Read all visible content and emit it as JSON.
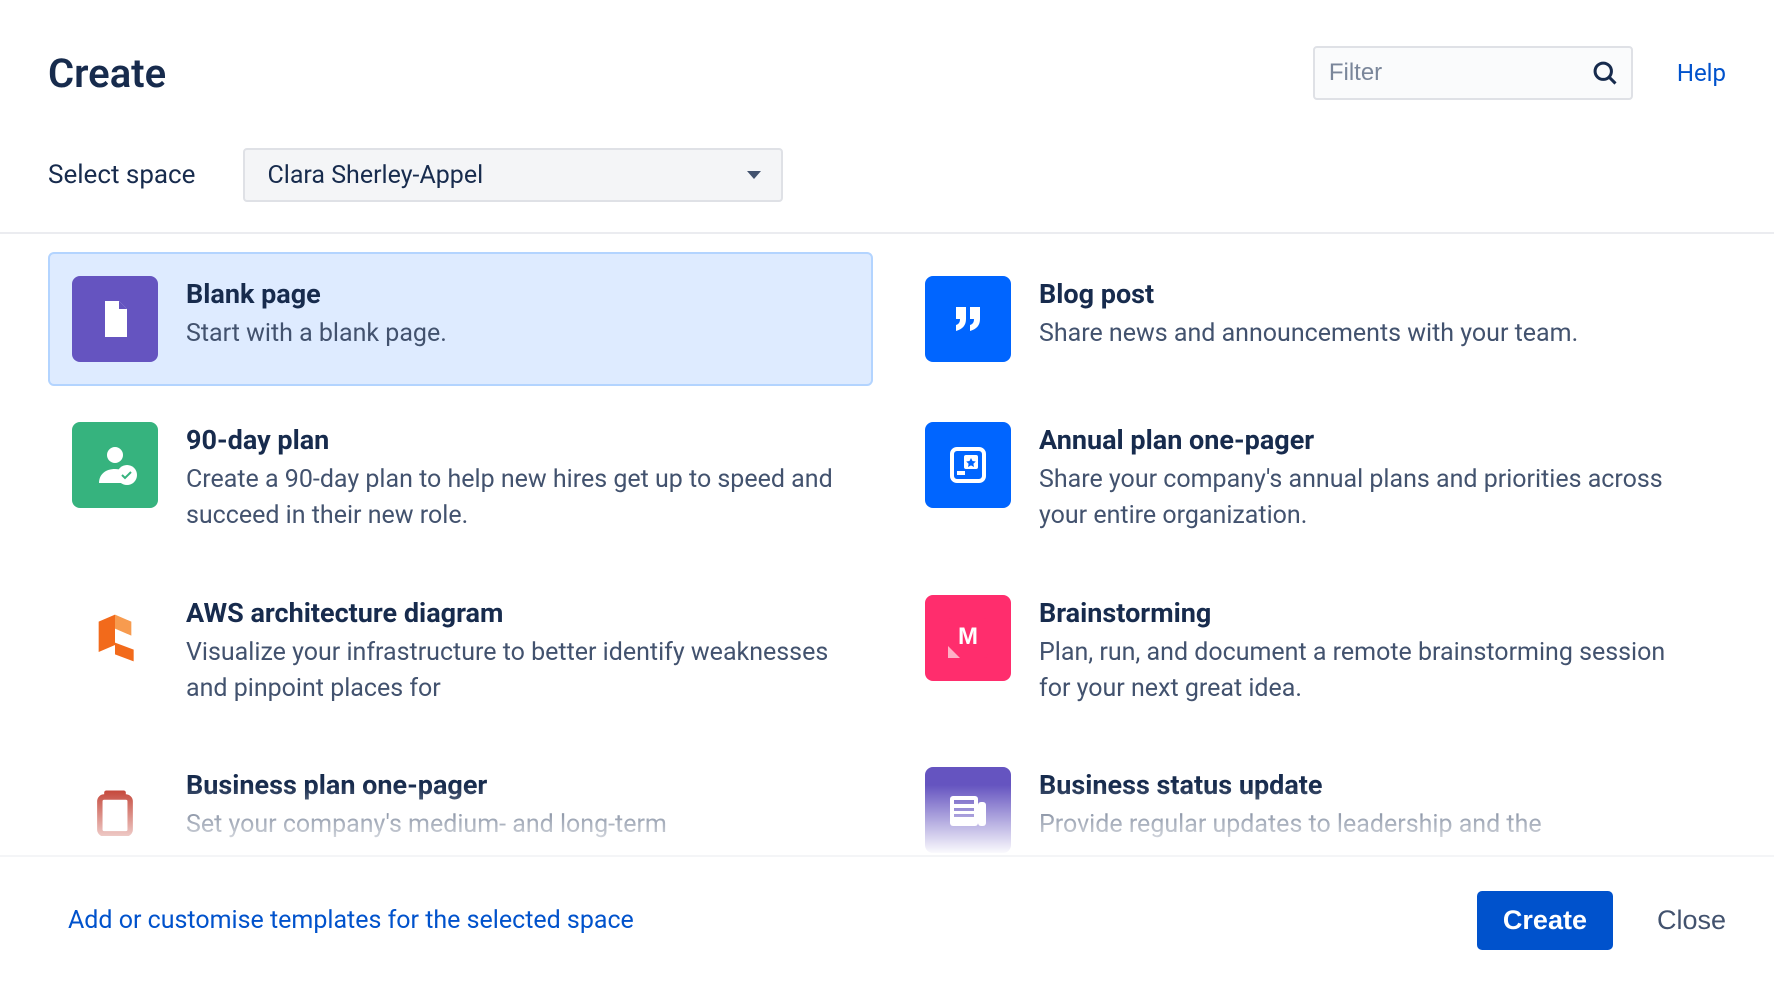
{
  "header": {
    "title": "Create",
    "filter_placeholder": "Filter",
    "help_label": "Help"
  },
  "space": {
    "label": "Select space",
    "selected": "Clara Sherley-Appel"
  },
  "templates": [
    {
      "id": "blank-page",
      "title": "Blank page",
      "desc": "Start with a blank page.",
      "icon": "page-icon",
      "icon_bg": "#6554c0",
      "selected": true
    },
    {
      "id": "blog-post",
      "title": "Blog post",
      "desc": "Share news and announcements with your team.",
      "icon": "quote-icon",
      "icon_bg": "#0065ff",
      "selected": false
    },
    {
      "id": "90-day-plan",
      "title": "90-day plan",
      "desc": "Create a 90-day plan to help new hires get up to speed and succeed in their new role.",
      "icon": "person-check-icon",
      "icon_bg": "#36b37e",
      "selected": false
    },
    {
      "id": "annual-plan-one-pager",
      "title": "Annual plan one-pager",
      "desc": "Share your company's annual plans and priorities across your entire organization.",
      "icon": "star-doc-icon",
      "icon_bg": "#0065ff",
      "selected": false
    },
    {
      "id": "aws-architecture-diagram",
      "title": "AWS architecture diagram",
      "desc": "Visualize your infrastructure to better identify weaknesses and pinpoint places for",
      "icon": "lucidchart-icon",
      "icon_bg": "transparent",
      "selected": false
    },
    {
      "id": "brainstorming",
      "title": "Brainstorming",
      "desc": "Plan, run, and document a remote brainstorming session for your next great idea.",
      "icon": "mural-icon",
      "icon_bg": "#ff2d6d",
      "selected": false
    },
    {
      "id": "business-plan-one-pager",
      "title": "Business plan one-pager",
      "desc": "Set your company's medium- and long-term",
      "icon": "clipboard-icon",
      "icon_bg": "transparent",
      "selected": false
    },
    {
      "id": "business-status-update",
      "title": "Business status update",
      "desc": "Provide regular updates to leadership and the",
      "icon": "news-icon",
      "icon_bg": "#6554c0",
      "selected": false
    }
  ],
  "footer": {
    "customise_label": "Add or customise templates for the selected space",
    "create_label": "Create",
    "close_label": "Close"
  }
}
